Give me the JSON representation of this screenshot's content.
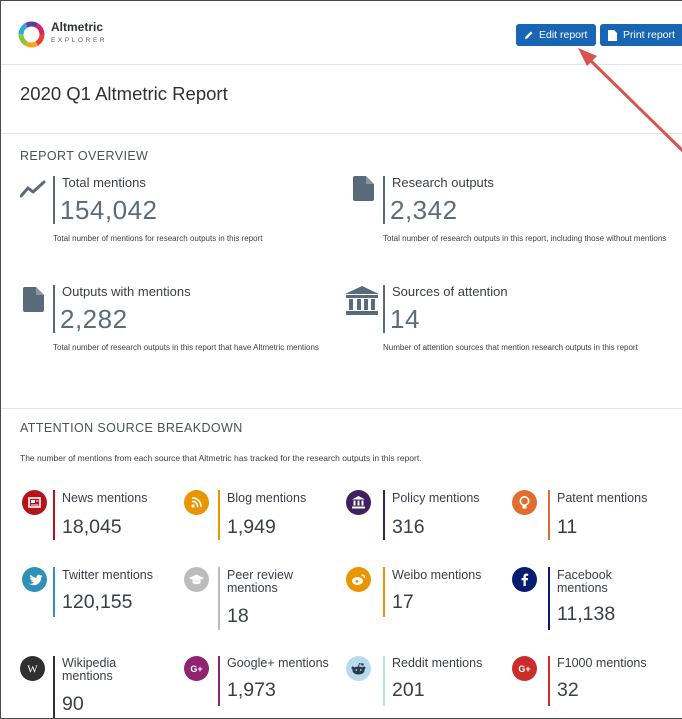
{
  "app": {
    "name": "Altmetric",
    "sub": "EXPLORER"
  },
  "toolbar": {
    "edit_label": "Edit report",
    "print_label": "Print report"
  },
  "report": {
    "title": "2020 Q1 Altmetric Report"
  },
  "overview": {
    "heading": "REPORT OVERVIEW",
    "cards": [
      {
        "label": "Total mentions",
        "value": "154,042",
        "desc": "Total number of mentions for research outputs in this report",
        "icon": "trend-line-icon"
      },
      {
        "label": "Research outputs",
        "value": "2,342",
        "desc": "Total number of research outputs in this report, including those without mentions",
        "icon": "document-icon"
      },
      {
        "label": "Outputs with mentions",
        "value": "2,282",
        "desc": "Total number of research outputs in this report that have Altmetric mentions",
        "icon": "document-icon"
      },
      {
        "label": "Sources of attention",
        "value": "14",
        "desc": "Number of attention sources that mention research outputs in this report",
        "icon": "institution-icon"
      }
    ]
  },
  "breakdown": {
    "heading": "ATTENTION SOURCE BREAKDOWN",
    "desc": "The number of mentions from each source that Altmetric has tracked for the research outputs in this report.",
    "sources": [
      {
        "label": "News mentions",
        "value": "18,045",
        "color": "#b5121b",
        "icon": "news-icon"
      },
      {
        "label": "Blog mentions",
        "value": "1,949",
        "color": "#e89500",
        "icon": "rss-icon"
      },
      {
        "label": "Policy mentions",
        "value": "316",
        "color": "#3e2160",
        "icon": "institution-icon"
      },
      {
        "label": "Patent mentions",
        "value": "11",
        "color": "#e06e30",
        "icon": "lightbulb-icon"
      },
      {
        "label": "Twitter mentions",
        "value": "120,155",
        "color": "#2f90b9",
        "icon": "twitter-icon"
      },
      {
        "label": "Peer review mentions",
        "value": "18",
        "color": "#bcbcbc",
        "icon": "graduation-cap-icon"
      },
      {
        "label": "Weibo mentions",
        "value": "17",
        "color": "#e89500",
        "icon": "weibo-icon"
      },
      {
        "label": "Facebook mentions",
        "value": "11,138",
        "color": "#071d70",
        "icon": "facebook-icon"
      },
      {
        "label": "Wikipedia mentions",
        "value": "90",
        "color": "#2f2f2f",
        "icon": "wikipedia-icon"
      },
      {
        "label": "Google+ mentions",
        "value": "1,973",
        "color": "#912470",
        "icon": "google-plus-icon"
      },
      {
        "label": "Reddit mentions",
        "value": "201",
        "color": "#b9dbf0",
        "icon": "reddit-icon"
      },
      {
        "label": "F1000 mentions",
        "value": "32",
        "color": "#cb2d2d",
        "icon": "google-plus-icon"
      }
    ]
  }
}
